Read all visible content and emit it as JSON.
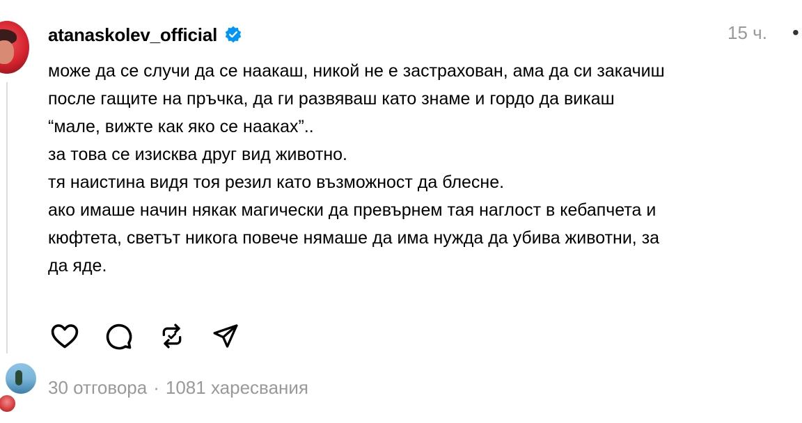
{
  "post": {
    "username": "atanaskolev_official",
    "verified": true,
    "timestamp": "15 ч.",
    "more_icon": "more-horizontal-icon",
    "lines": [
      "може да се случи да се наакаш, никой не е застрахован, ама да си закачиш",
      "после гащите на пръчка, да ги развяваш като знаме и гордо да викаш",
      "“мале, вижте как яко се наакаx”..",
      "за това се изисква друг вид животно.",
      "тя наистина видя тоя резил като възможност да блесне.",
      "ако имаше начин някак магически да превърнем тая наглост в кебапчета и",
      "кюфтета, светът никога повече нямаше да има нужда да убива животни, за",
      "да яде."
    ]
  },
  "actions": {
    "like_icon": "heart-icon",
    "reply_icon": "comment-icon",
    "repost_icon": "repost-icon",
    "share_icon": "send-icon"
  },
  "stats": {
    "replies": "30 отговора",
    "separator": "·",
    "likes": "1081 харесвания"
  },
  "colors": {
    "verified_blue": "#0095f6",
    "secondary_text": "#999999",
    "avatar_red": "#d4232e"
  }
}
